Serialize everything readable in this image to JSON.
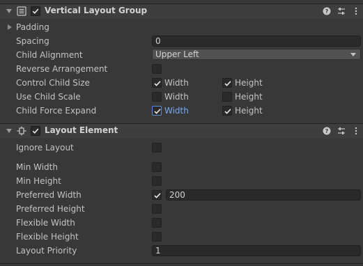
{
  "vertical_layout_group": {
    "title": "Vertical Layout Group",
    "enabled": true,
    "padding_label": "Padding",
    "spacing": {
      "label": "Spacing",
      "value": "0"
    },
    "child_alignment": {
      "label": "Child Alignment",
      "value": "Upper Left"
    },
    "reverse_arrangement": {
      "label": "Reverse Arrangement",
      "checked": false
    },
    "control_child_size": {
      "label": "Control Child Size",
      "width_label": "Width",
      "width": true,
      "height_label": "Height",
      "height": true
    },
    "use_child_scale": {
      "label": "Use Child Scale",
      "width_label": "Width",
      "width": false,
      "height_label": "Height",
      "height": false
    },
    "child_force_expand": {
      "label": "Child Force Expand",
      "width_label": "Width",
      "width": true,
      "height_label": "Height",
      "height": true
    }
  },
  "layout_element": {
    "title": "Layout Element",
    "enabled": true,
    "ignore_layout": {
      "label": "Ignore Layout",
      "checked": false
    },
    "min_width": {
      "label": "Min Width",
      "checked": false
    },
    "min_height": {
      "label": "Min Height",
      "checked": false
    },
    "preferred_width": {
      "label": "Preferred Width",
      "checked": true,
      "value": "200"
    },
    "preferred_height": {
      "label": "Preferred Height",
      "checked": false
    },
    "flexible_width": {
      "label": "Flexible Width",
      "checked": false
    },
    "flexible_height": {
      "label": "Flexible Height",
      "checked": false
    },
    "layout_priority": {
      "label": "Layout Priority",
      "value": "1"
    }
  },
  "icons": {
    "component_menu": "list-icon",
    "layout_element": "layout-element-icon",
    "help": "help-icon",
    "presets": "presets-icon",
    "more": "more-vertical-icon"
  },
  "colors": {
    "background": "#383838",
    "header": "#3e3e3e",
    "field": "#2a2a2a",
    "focus_accent": "#7ba7e8"
  }
}
